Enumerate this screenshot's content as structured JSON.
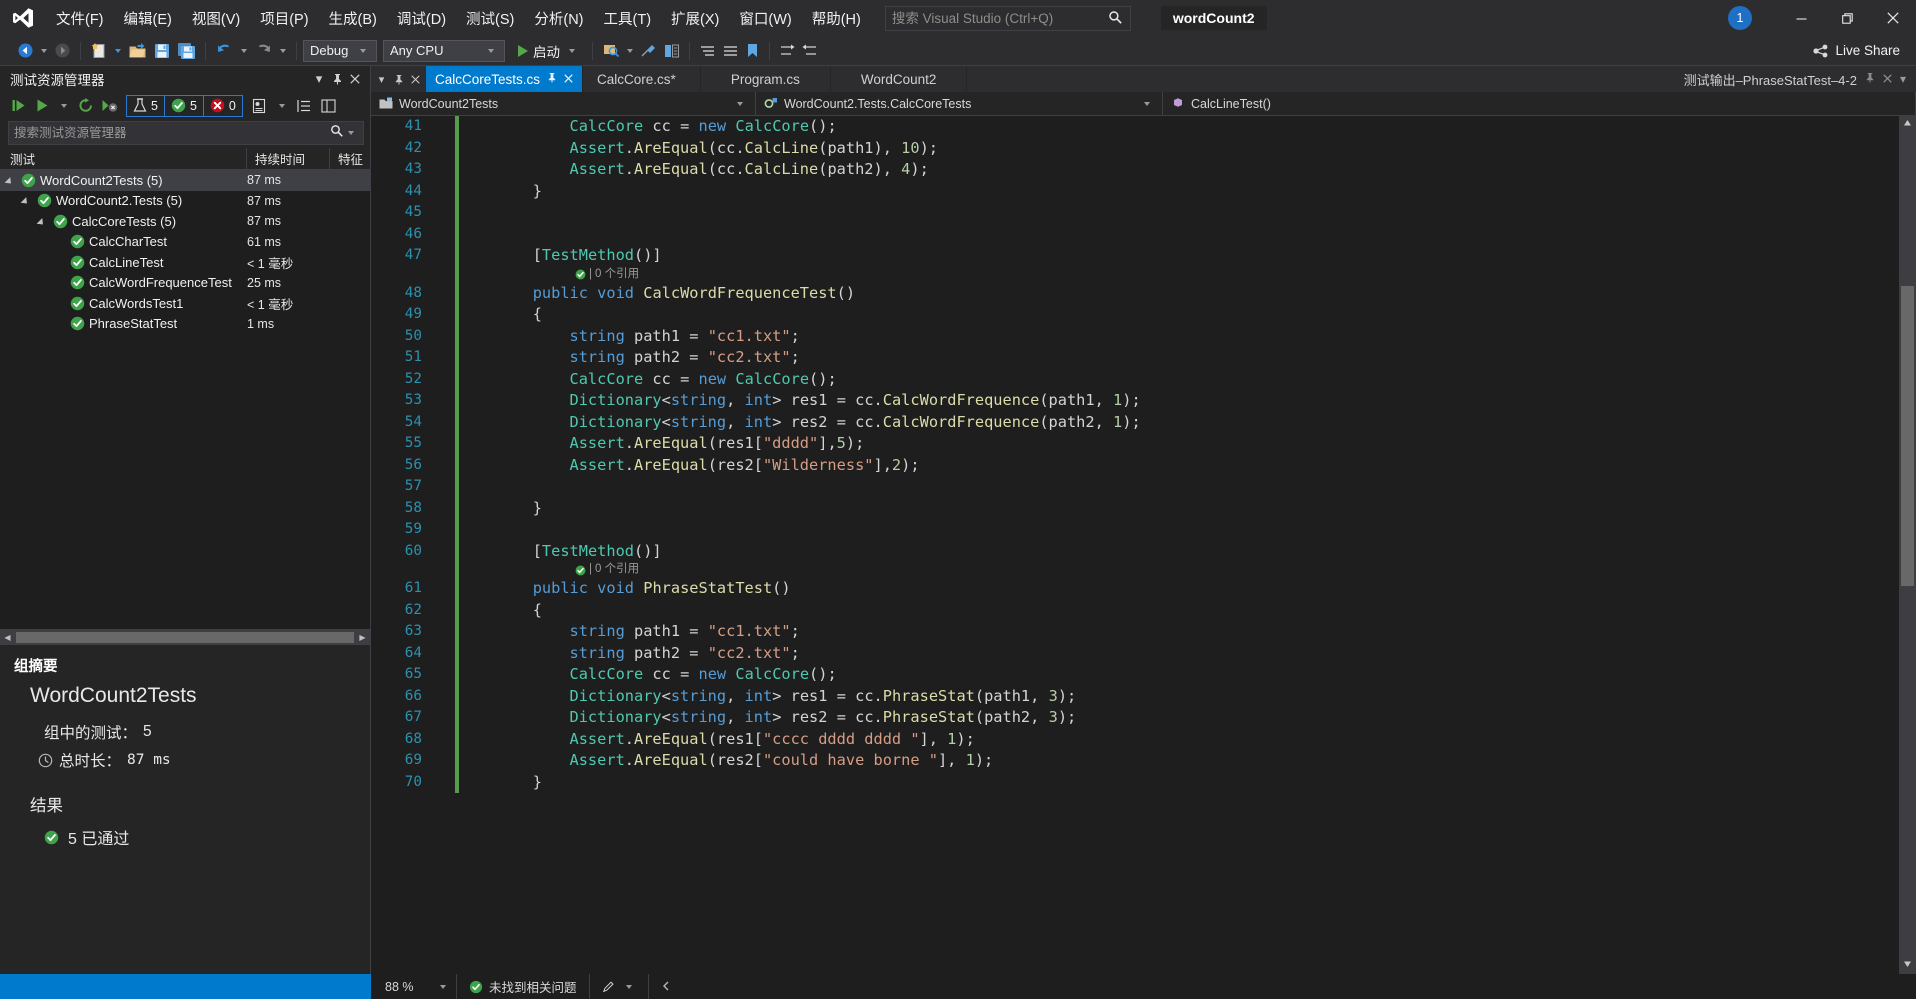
{
  "titlebar": {
    "logo_icon": "visual-studio-logo",
    "menus": [
      {
        "label": "文件(F)"
      },
      {
        "label": "编辑(E)"
      },
      {
        "label": "视图(V)"
      },
      {
        "label": "项目(P)"
      },
      {
        "label": "生成(B)"
      },
      {
        "label": "调试(D)"
      },
      {
        "label": "测试(S)"
      },
      {
        "label": "分析(N)"
      },
      {
        "label": "工具(T)"
      },
      {
        "label": "扩展(X)"
      },
      {
        "label": "窗口(W)"
      },
      {
        "label": "帮助(H)"
      }
    ],
    "search_placeholder": "搜索 Visual Studio (Ctrl+Q)",
    "search_value": "",
    "search_icon": "search-icon",
    "solution_name": "wordCount2",
    "notification_count": "1",
    "minimize_glyph": "—",
    "restore_glyph": "❐",
    "close_glyph": "✕"
  },
  "toolbar": {
    "nav_back_icon": "navigate-back-icon",
    "nav_forward_icon": "navigate-forward-icon",
    "new_item_icon": "new-item-icon",
    "open_file_icon": "open-file-icon",
    "save_icon": "save-icon",
    "save_all_icon": "save-all-icon",
    "undo_icon": "undo-icon",
    "redo_icon": "redo-icon",
    "configuration": "Debug",
    "platform": "Any CPU",
    "start_label": "启动",
    "start_icon": "play-icon",
    "live_share_label": "Live Share",
    "live_share_icon": "live-share-icon"
  },
  "test_explorer": {
    "title": "测试资源管理器",
    "header_icons": [
      "chevron-down-icon",
      "pin-icon",
      "close-icon"
    ],
    "toolbar_icons": [
      "run-all-tests-icon",
      "run-tests-icon",
      "run-dropdown-icon",
      "repeat-last-run-icon",
      "cancel-run-icon"
    ],
    "counters": [
      {
        "icon": "flask-icon",
        "value": "5",
        "name": "total-tests"
      },
      {
        "icon": "passed-icon",
        "value": "5",
        "name": "passed-tests"
      },
      {
        "icon": "failed-icon",
        "value": "0",
        "name": "failed-tests"
      }
    ],
    "extra_icons": [
      "test-settings-icon",
      "group-by-icon",
      "columns-icon"
    ],
    "search_placeholder": "搜索测试资源管理器",
    "search_value": "",
    "columns": {
      "test": "测试",
      "duration": "持续时间",
      "traits": "特征"
    },
    "rows": [
      {
        "label": "WordCount2Tests (5)",
        "duration": "87 ms",
        "traits": "",
        "indent": 0,
        "expander": true,
        "selected": true,
        "status": "passed"
      },
      {
        "label": "WordCount2.Tests (5)",
        "duration": "87 ms",
        "traits": "",
        "indent": 1,
        "expander": true,
        "selected": false,
        "status": "passed"
      },
      {
        "label": "CalcCoreTests (5)",
        "duration": "87 ms",
        "traits": "",
        "indent": 2,
        "expander": true,
        "selected": false,
        "status": "passed"
      },
      {
        "label": "CalcCharTest",
        "duration": "61 ms",
        "traits": "",
        "indent": 3,
        "expander": false,
        "selected": false,
        "status": "passed"
      },
      {
        "label": "CalcLineTest",
        "duration": "< 1 毫秒",
        "traits": "",
        "indent": 3,
        "expander": false,
        "selected": false,
        "status": "passed"
      },
      {
        "label": "CalcWordFrequenceTest",
        "duration": "25 ms",
        "traits": "",
        "indent": 3,
        "expander": false,
        "selected": false,
        "status": "passed"
      },
      {
        "label": "CalcWordsTest1",
        "duration": "< 1 毫秒",
        "traits": "",
        "indent": 3,
        "expander": false,
        "selected": false,
        "status": "passed"
      },
      {
        "label": "PhraseStatTest",
        "duration": "1 ms",
        "traits": "",
        "indent": 3,
        "expander": false,
        "selected": false,
        "status": "passed"
      }
    ],
    "summary": {
      "title": "组摘要",
      "group_name": "WordCount2Tests",
      "tests_in_group_label": "组中的测试：",
      "tests_in_group_value": "5",
      "duration_label": "总时长：",
      "duration_value": "87 ms",
      "duration_icon": "clock-icon",
      "results_label": "结果",
      "result_icon": "passed-icon",
      "result_text": "5  已通过"
    }
  },
  "editor": {
    "lead_icons": [
      "chevron-down-icon",
      "pin-icon",
      "close-icon"
    ],
    "tabs": [
      {
        "label": "CalcCoreTests.cs",
        "active": true,
        "pin": "⊸",
        "close": "✕"
      },
      {
        "label": "CalcCore.cs*",
        "active": false
      },
      {
        "label": "Program.cs",
        "active": false
      },
      {
        "label": "WordCount2",
        "active": false
      }
    ],
    "tool_window_title": "测试输出–PhraseStatTest–4-2",
    "tool_window_icons": [
      "pin-icon",
      "close-icon",
      "chevron-down-icon"
    ],
    "breadcrumb": [
      {
        "icon": "project-icon",
        "label": "WordCount2Tests"
      },
      {
        "icon": "class-icon",
        "label": "WordCount2.Tests.CalcCoreTests"
      },
      {
        "icon": "method-icon",
        "label": "CalcLineTest()"
      }
    ],
    "first_line_number": 40,
    "lines": [
      {
        "n": 41,
        "text": "            CalcCore cc = new CalcCore();"
      },
      {
        "n": 42,
        "text": "            Assert.AreEqual(cc.CalcLine(path1), 10);"
      },
      {
        "n": 43,
        "text": "            Assert.AreEqual(cc.CalcLine(path2), 4);"
      },
      {
        "n": 44,
        "text": "        }"
      },
      {
        "n": 45,
        "text": ""
      },
      {
        "n": 46,
        "text": ""
      },
      {
        "n": 47,
        "text": "        [TestMethod()]"
      },
      {
        "n": 48,
        "text": "        public void CalcWordFrequenceTest()"
      },
      {
        "n": 49,
        "text": "        {"
      },
      {
        "n": 50,
        "text": "            string path1 = \"cc1.txt\";"
      },
      {
        "n": 51,
        "text": "            string path2 = \"cc2.txt\";"
      },
      {
        "n": 52,
        "text": "            CalcCore cc = new CalcCore();"
      },
      {
        "n": 53,
        "text": "            Dictionary<string, int> res1 = cc.CalcWordFrequence(path1, 1);"
      },
      {
        "n": 54,
        "text": "            Dictionary<string, int> res2 = cc.CalcWordFrequence(path2, 1);"
      },
      {
        "n": 55,
        "text": "            Assert.AreEqual(res1[\"dddd\"],5);"
      },
      {
        "n": 56,
        "text": "            Assert.AreEqual(res2[\"Wilderness\"],2);"
      },
      {
        "n": 57,
        "text": ""
      },
      {
        "n": 58,
        "text": "        }"
      },
      {
        "n": 59,
        "text": ""
      },
      {
        "n": 60,
        "text": "        [TestMethod()]"
      },
      {
        "n": 61,
        "text": "        public void PhraseStatTest()"
      },
      {
        "n": 62,
        "text": "        {"
      },
      {
        "n": 63,
        "text": "            string path1 = \"cc1.txt\";"
      },
      {
        "n": 64,
        "text": "            string path2 = \"cc2.txt\";"
      },
      {
        "n": 65,
        "text": "            CalcCore cc = new CalcCore();"
      },
      {
        "n": 66,
        "text": "            Dictionary<string, int> res1 = cc.PhraseStat(path1, 3);"
      },
      {
        "n": 67,
        "text": "            Dictionary<string, int> res2 = cc.PhraseStat(path2, 3);"
      },
      {
        "n": 68,
        "text": "            Assert.AreEqual(res1[\"cccc dddd dddd \"], 1);"
      },
      {
        "n": 69,
        "text": "            Assert.AreEqual(res2[\"could have borne \"], 1);"
      },
      {
        "n": 70,
        "text": "        }"
      }
    ],
    "codelens": [
      {
        "after_line": 47,
        "text": "0 个引用"
      },
      {
        "after_line": 60,
        "text": "0 个引用"
      }
    ]
  },
  "statusbar": {
    "zoom_level": "88 %",
    "issues_icon": "check-icon",
    "issues_text": "未找到相关问题",
    "pen_icon": "pen-icon",
    "nav_left_icon": "chevron-left-icon"
  },
  "colors": {
    "accent": "#007acc",
    "titlebar_bg": "#2d2d30",
    "editor_bg": "#1e1e1e",
    "panel_bg": "#252526",
    "pass_green": "#4EA72E",
    "fail_red": "#C50F1F",
    "keyword_blue": "#569cd6",
    "type_teal": "#4ec9b0",
    "string_orange": "#d69d85",
    "number_green": "#b5cea8",
    "linenum_blue": "#2b91af"
  }
}
